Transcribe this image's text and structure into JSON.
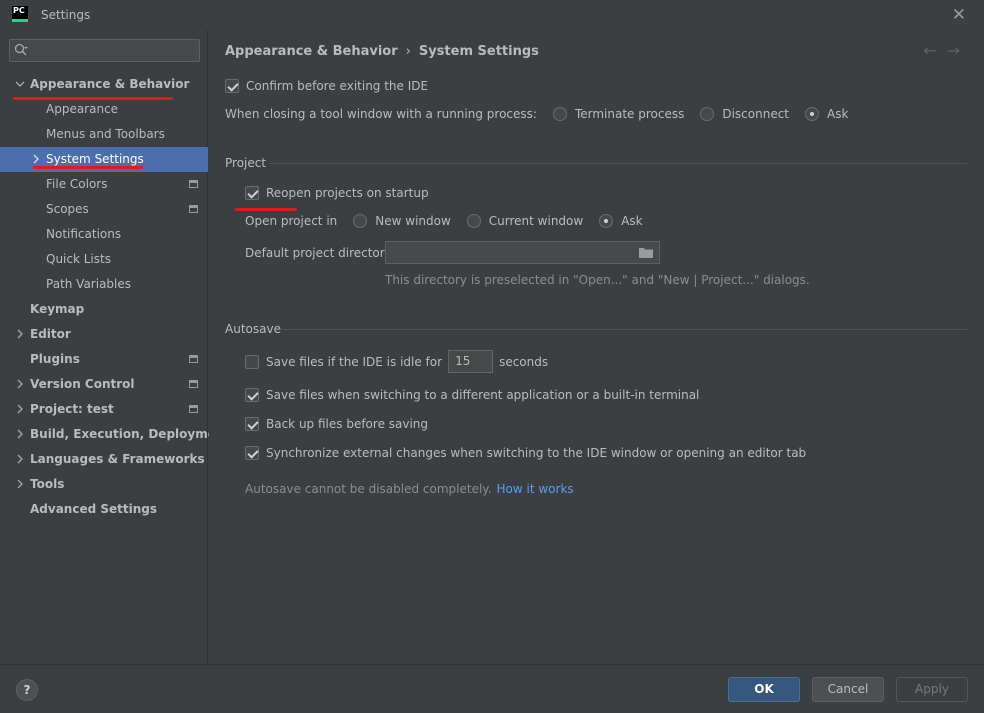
{
  "window": {
    "title": "Settings",
    "logo_text": "PC"
  },
  "sidebar": {
    "search_placeholder": "",
    "items": [
      {
        "label": "Appearance & Behavior"
      },
      {
        "label": "Appearance"
      },
      {
        "label": "Menus and Toolbars"
      },
      {
        "label": "System Settings"
      },
      {
        "label": "File Colors"
      },
      {
        "label": "Scopes"
      },
      {
        "label": "Notifications"
      },
      {
        "label": "Quick Lists"
      },
      {
        "label": "Path Variables"
      },
      {
        "label": "Keymap"
      },
      {
        "label": "Editor"
      },
      {
        "label": "Plugins"
      },
      {
        "label": "Version Control"
      },
      {
        "label": "Project: test"
      },
      {
        "label": "Build, Execution, Deployment"
      },
      {
        "label": "Languages & Frameworks"
      },
      {
        "label": "Tools"
      },
      {
        "label": "Advanced Settings"
      }
    ]
  },
  "breadcrumb": {
    "parent": "Appearance & Behavior",
    "sep": "›",
    "current": "System Settings"
  },
  "general": {
    "confirm_exit": "Confirm before exiting the IDE",
    "closing_label": "When closing a tool window with a running process:",
    "closing_options": [
      "Terminate process",
      "Disconnect",
      "Ask"
    ]
  },
  "project": {
    "title": "Project",
    "reopen": "Reopen projects on startup",
    "open_in_label": "Open project in",
    "open_in_options": [
      "New window",
      "Current window",
      "Ask"
    ],
    "default_dir_label": "Default project directory:",
    "default_dir_value": "",
    "default_dir_hint": "This directory is preselected in \"Open...\" and \"New | Project...\" dialogs."
  },
  "autosave": {
    "title": "Autosave",
    "idle_label": "Save files if the IDE is idle for",
    "idle_value": "15",
    "idle_unit": "seconds",
    "switch_app": "Save files when switching to a different application or a built-in terminal",
    "backup": "Back up files before saving",
    "sync": "Synchronize external changes when switching to the IDE window or opening an editor tab",
    "note": "Autosave cannot be disabled completely.",
    "note_link": "How it works"
  },
  "footer": {
    "ok": "OK",
    "cancel": "Cancel",
    "apply": "Apply",
    "help": "?"
  },
  "colors": {
    "accent": "#4b6eaf",
    "annotation": "#e01b1b",
    "link": "#589df6"
  }
}
